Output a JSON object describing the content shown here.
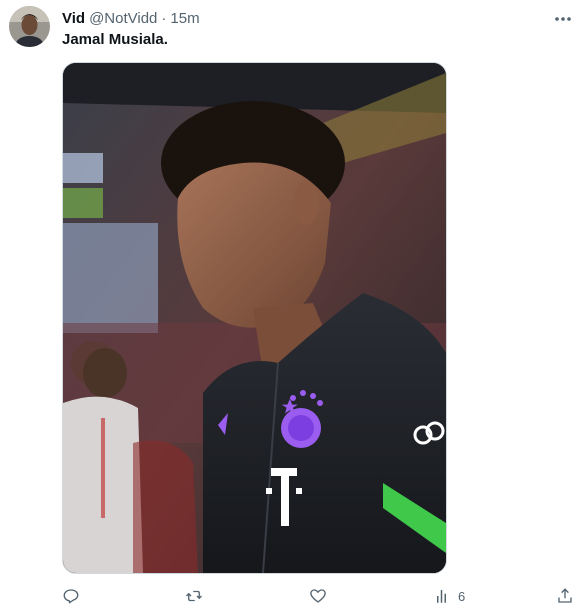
{
  "tweet": {
    "author_name": "Vid",
    "author_handle": "@NotVidd",
    "separator": "·",
    "timestamp": "15m",
    "text": "Jamal Musiala.",
    "views_count": "6"
  },
  "icons": {
    "more": "more-horizontal-icon",
    "reply": "reply-icon",
    "retweet": "retweet-icon",
    "like": "heart-icon",
    "views": "analytics-icon",
    "share": "share-icon"
  },
  "colors": {
    "text_primary": "#0f1419",
    "text_secondary": "#536471",
    "border": "#cfd9de",
    "jacket_purple": "#9b5cf0",
    "stripe_green": "#3fc84a"
  }
}
